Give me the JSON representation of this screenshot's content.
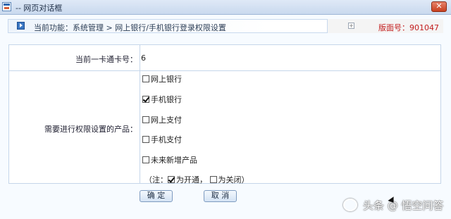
{
  "window": {
    "title": "-- 网页对话框",
    "close_label": "✕"
  },
  "breadcrumb": {
    "text": "当前功能：系统管理 > 网上银行/手机银行登录权限设置",
    "page_number": "版面号：901047"
  },
  "form": {
    "card_label": "当前一卡通卡号：",
    "card_value": "6",
    "product_label": "需要进行权限设置的产品：",
    "products": [
      {
        "label": "网上银行",
        "checked": false
      },
      {
        "label": "手机银行",
        "checked": true
      },
      {
        "label": "网上支付",
        "checked": false
      },
      {
        "label": "手机支付",
        "checked": false
      },
      {
        "label": "未来新增产品",
        "checked": false
      }
    ],
    "note_prefix": "（注：",
    "note_open": "为开通，",
    "note_close": "为关闭）"
  },
  "buttons": {
    "confirm": "确 定",
    "cancel": "取 消"
  },
  "watermark": {
    "text": "头条 @ 悟空问答"
  }
}
